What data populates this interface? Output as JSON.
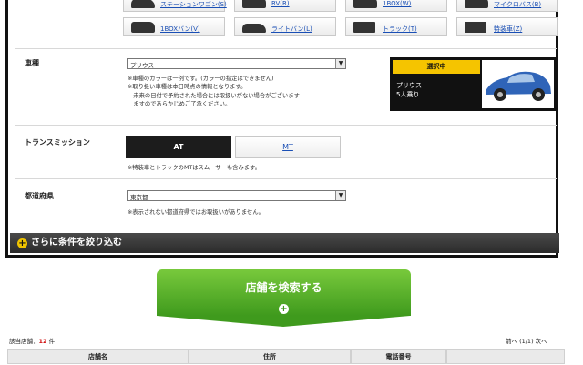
{
  "vehicle_types": {
    "row1": [
      "ステーションワゴン(S)",
      "RV(R)",
      "1BOX(W)",
      "マイクロバス(B)"
    ],
    "row2": [
      "1BOXバン(V)",
      "ライトバン(L)",
      "トラック(T)",
      "特装車(Z)"
    ]
  },
  "car_model": {
    "label": "車種",
    "select_value": "プリウス",
    "notes": [
      "※車種のカラーは一例です。(カラーの指定はできません)",
      "※取り扱い車種は本日時点の情報となります。",
      "　未来の日付で予約された場合には取扱いがない場合がございます",
      "　ますのであらかじめご了承ください。"
    ],
    "selected_badge": "選択中",
    "selected_name": "プリウス",
    "selected_capacity": "5人乗り"
  },
  "transmission": {
    "label": "トランスミッション",
    "options": [
      "AT",
      "MT"
    ],
    "note": "※特装車とトラックのMTはスムーサーも含みます。"
  },
  "prefecture": {
    "label": "都道府県",
    "select_value": "東京都",
    "note": "※表示されない都道府県ではお取扱いがありません。"
  },
  "narrow_conditions": "さらに条件を絞り込む",
  "search_button": "店舗を検索する",
  "results": {
    "label": "該当店舗：",
    "count": "12",
    "unit": "件",
    "pager": "前へ (1/1) 次へ"
  },
  "table_headers": [
    "店舗名",
    "住所",
    "電話番号"
  ],
  "colors": {
    "accent_yellow": "#f5c400",
    "search_green": "#4fae27",
    "link_blue": "#1a4fb5",
    "count_red": "#d01010"
  }
}
